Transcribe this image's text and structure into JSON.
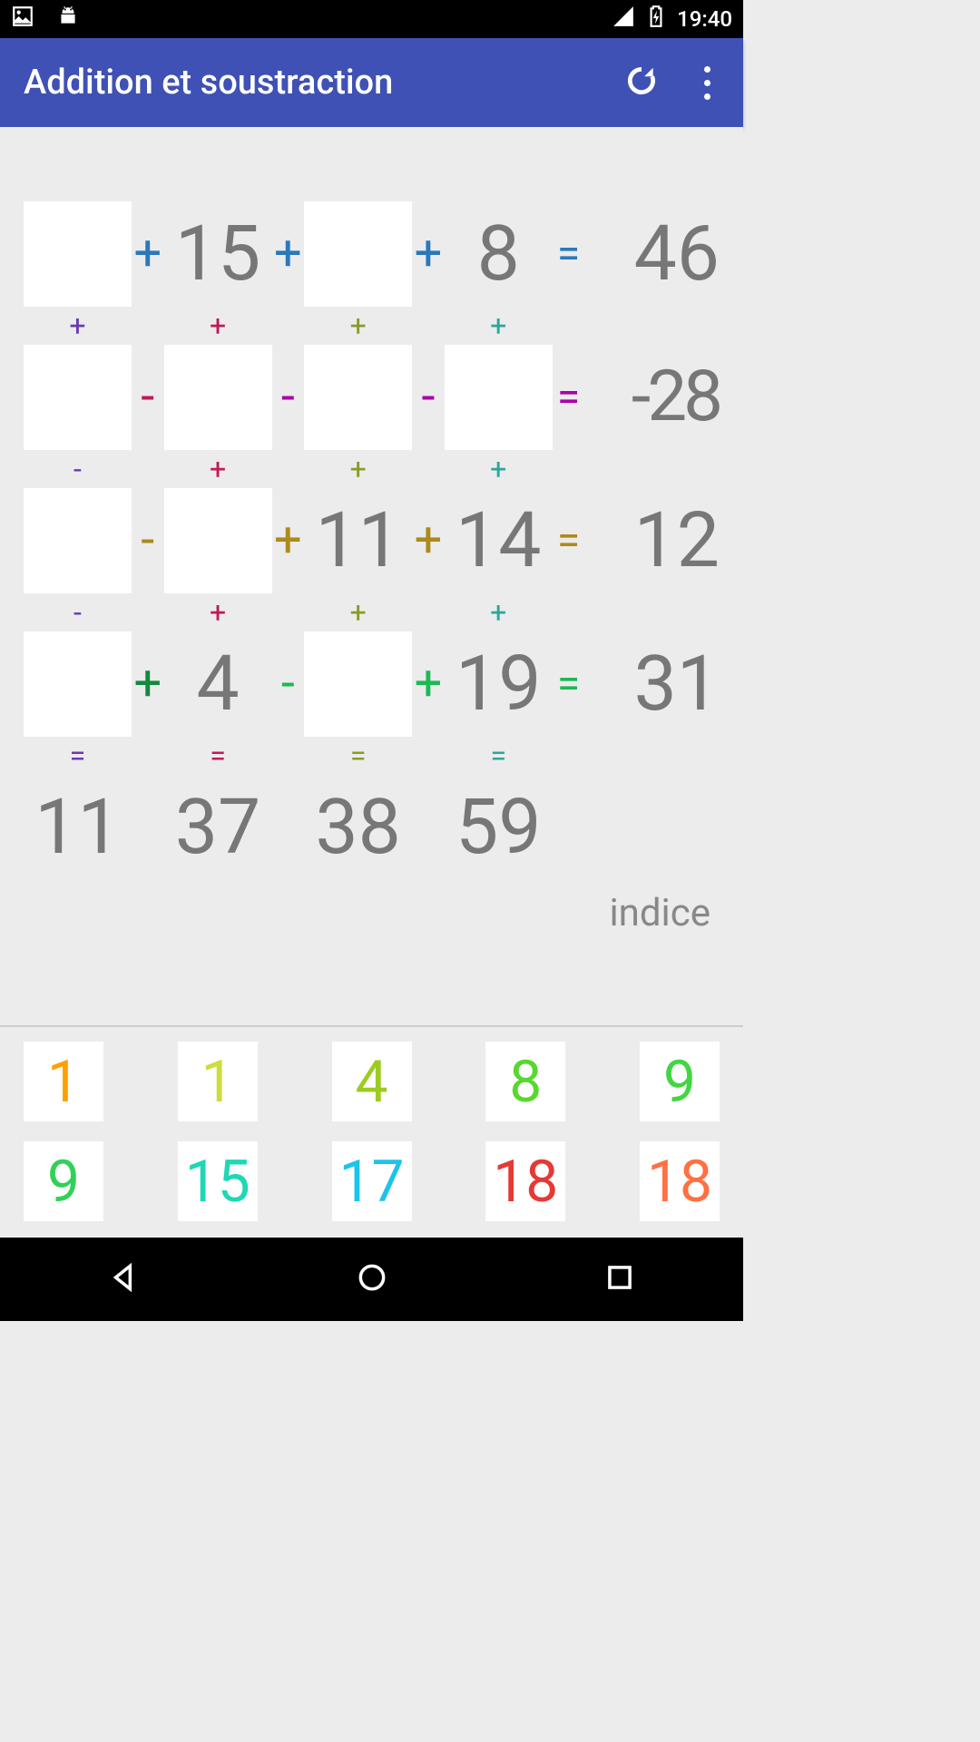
{
  "status": {
    "time": "19:40"
  },
  "header": {
    "title": "Addition et soustraction"
  },
  "grid": {
    "rows": [
      {
        "cells": [
          {
            "type": "slot"
          },
          {
            "type": "op",
            "val": "+",
            "color": "c-blue"
          },
          {
            "type": "num",
            "val": "15"
          },
          {
            "type": "op",
            "val": "+",
            "color": "c-blue"
          },
          {
            "type": "slot"
          },
          {
            "type": "op",
            "val": "+",
            "color": "c-blue"
          },
          {
            "type": "num",
            "val": "8"
          },
          {
            "type": "eq",
            "val": "=",
            "color": "c-blue"
          },
          {
            "type": "res",
            "val": "46"
          }
        ]
      },
      {
        "cells": [
          {
            "type": "slot"
          },
          {
            "type": "op",
            "val": "-",
            "color": "c-pink"
          },
          {
            "type": "slot"
          },
          {
            "type": "op",
            "val": "-",
            "color": "c-mag"
          },
          {
            "type": "slot"
          },
          {
            "type": "op",
            "val": "-",
            "color": "c-mag"
          },
          {
            "type": "slot"
          },
          {
            "type": "eq",
            "val": "=",
            "color": "c-mag"
          },
          {
            "type": "res",
            "val": "-28",
            "neg": true
          }
        ]
      },
      {
        "cells": [
          {
            "type": "slot"
          },
          {
            "type": "op",
            "val": "-",
            "color": "c-ochre"
          },
          {
            "type": "slot"
          },
          {
            "type": "op",
            "val": "+",
            "color": "c-ochre"
          },
          {
            "type": "num",
            "val": "11"
          },
          {
            "type": "op",
            "val": "+",
            "color": "c-ochre"
          },
          {
            "type": "num",
            "val": "14"
          },
          {
            "type": "eq",
            "val": "=",
            "color": "c-ochre"
          },
          {
            "type": "res",
            "val": "12"
          }
        ]
      },
      {
        "cells": [
          {
            "type": "slot"
          },
          {
            "type": "op",
            "val": "+",
            "color": "c-darkg"
          },
          {
            "type": "num",
            "val": "4"
          },
          {
            "type": "op",
            "val": "-",
            "color": "c-green"
          },
          {
            "type": "slot"
          },
          {
            "type": "op",
            "val": "+",
            "color": "c-green"
          },
          {
            "type": "num",
            "val": "19"
          },
          {
            "type": "eq",
            "val": "=",
            "color": "c-green"
          },
          {
            "type": "res",
            "val": "31"
          }
        ]
      }
    ],
    "vops": [
      [
        {
          "val": "+",
          "color": "c-purple"
        },
        {
          "val": "+",
          "color": "c-pink"
        },
        {
          "val": "+",
          "color": "c-olive"
        },
        {
          "val": "+",
          "color": "c-teal"
        }
      ],
      [
        {
          "val": "-",
          "color": "c-purple"
        },
        {
          "val": "+",
          "color": "c-pink"
        },
        {
          "val": "+",
          "color": "c-olive"
        },
        {
          "val": "+",
          "color": "c-teal"
        }
      ],
      [
        {
          "val": "-",
          "color": "c-purple"
        },
        {
          "val": "+",
          "color": "c-pink"
        },
        {
          "val": "+",
          "color": "c-olive"
        },
        {
          "val": "+",
          "color": "c-teal"
        }
      ],
      [
        {
          "val": "=",
          "color": "c-purple"
        },
        {
          "val": "=",
          "color": "c-pink"
        },
        {
          "val": "=",
          "color": "c-olive"
        },
        {
          "val": "=",
          "color": "c-teal"
        }
      ]
    ],
    "col_results": [
      "11",
      "37",
      "38",
      "59"
    ]
  },
  "hint": {
    "label": "indice"
  },
  "palette": {
    "row1": [
      {
        "val": "1",
        "color": "c-amber"
      },
      {
        "val": "1",
        "color": "c-yellow"
      },
      {
        "val": "4",
        "color": "c-lime"
      },
      {
        "val": "8",
        "color": "c-ngreen"
      },
      {
        "val": "9",
        "color": "c-lgreen"
      }
    ],
    "row2": [
      {
        "val": "9",
        "color": "c-lgrn2"
      },
      {
        "val": "15",
        "color": "c-cyan2"
      },
      {
        "val": "17",
        "color": "c-cyan"
      },
      {
        "val": "18",
        "color": "c-red"
      },
      {
        "val": "18",
        "color": "c-orange"
      }
    ]
  }
}
